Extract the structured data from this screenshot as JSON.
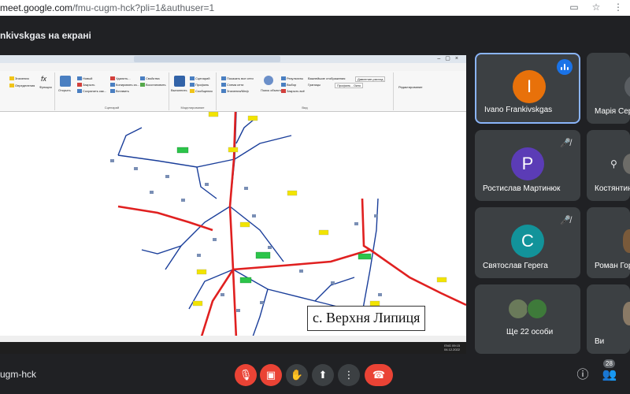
{
  "browser": {
    "url_host": "meet.google.com",
    "url_path": "/fmu-cugm-hck?pli=1&authuser=1"
  },
  "header": {
    "presenting_text": "nkivskgas на екрані"
  },
  "shared_screen": {
    "ribbon_groups": [
      "Сценарий",
      "Моделирование",
      "Вид",
      "Редактирование"
    ],
    "ribbon_items": {
      "g1": [
        "Значения",
        "Определения",
        "Функция"
      ],
      "g2": [
        "Открыть",
        "Новый",
        "Закрыть",
        "Сохранить как...",
        "Удалить...",
        "Копировать из...",
        "Вставить",
        "Свойства",
        "Восстановить"
      ],
      "g3": [
        "Выполнить",
        "Сценарий",
        "Профиль",
        "Сообщения"
      ],
      "g4": [
        "Показать все сети",
        "Схема сети",
        "Значения/Мнф",
        "Поиск объекта"
      ],
      "g5": [
        "Результаты",
        "Выбор",
        "Закрыть всё",
        "Важнейшие отображения",
        "Давление-расход",
        "Границы",
        "Профиль - Окно"
      ]
    },
    "village_label": "с. Верхня Липиця",
    "clock_time": "09:15",
    "clock_date": "04.12.2022",
    "lang": "ENG"
  },
  "participants": [
    {
      "initial": "I",
      "name": "Ivano Frankivskgas",
      "color": "#e8710a",
      "speaking": true,
      "muted": false
    },
    {
      "initial": "",
      "name": "Марія Сер",
      "color": "",
      "speaking": false,
      "muted": false
    },
    {
      "initial": "P",
      "name": "Ростислав Мартинюк",
      "color": "#5b3cb6",
      "speaking": false,
      "muted": true
    },
    {
      "initial": "",
      "name": "Костянтин",
      "color": "",
      "speaking": false,
      "muted": false
    },
    {
      "initial": "C",
      "name": "Святослав Герега",
      "color": "#12939a",
      "speaking": false,
      "muted": true
    },
    {
      "initial": "",
      "name": "Роман Гор",
      "color": "",
      "speaking": false,
      "muted": false
    },
    {
      "initial": "",
      "name": "Ще 22 особи",
      "color": "",
      "speaking": false,
      "muted": false
    },
    {
      "initial": "",
      "name": "Ви",
      "color": "",
      "speaking": false,
      "muted": false
    }
  ],
  "bottom": {
    "meeting_code": "ugm-hck",
    "participants_count": "28"
  },
  "colors": {
    "accent": "#8ab4f8",
    "danger": "#ea4335",
    "tile": "#3c4043",
    "bg": "#202124"
  }
}
